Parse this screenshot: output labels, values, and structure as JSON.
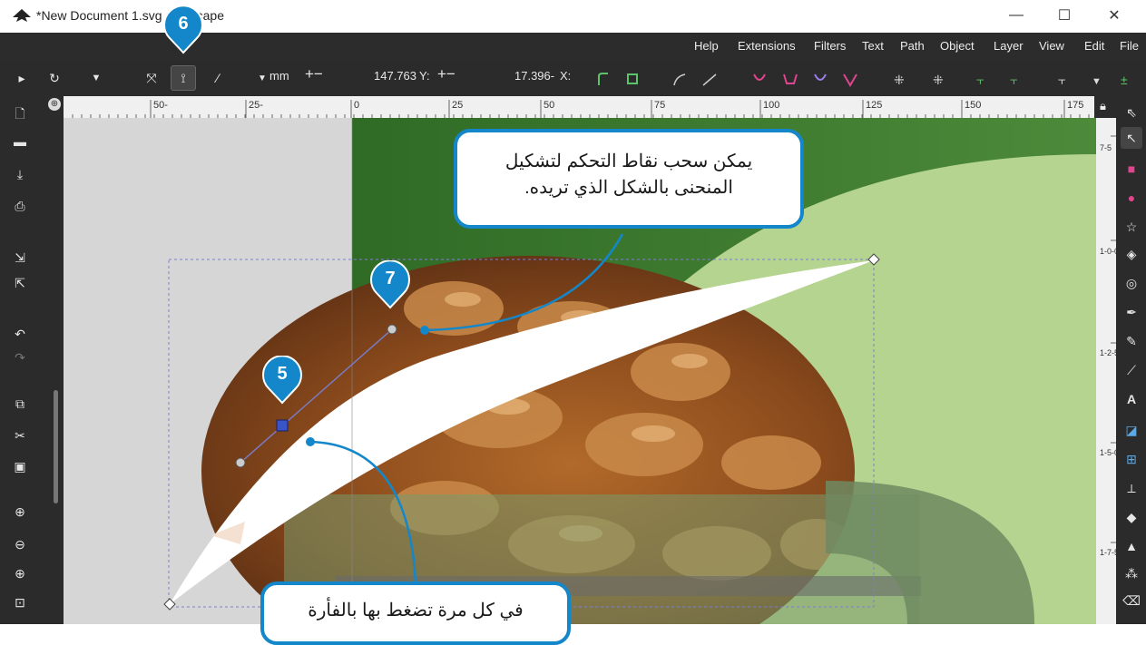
{
  "window": {
    "title": "*New Document 1.svg - Inkscape",
    "minimize": "—",
    "maximize": "☐",
    "close": "✕"
  },
  "menu": [
    "Help",
    "Extensions",
    "Filters",
    "Text",
    "Path",
    "Object",
    "Layer",
    "View",
    "Edit",
    "File"
  ],
  "toolbar": {
    "unit": "mm",
    "y_label": "Y:",
    "x_label": "X:",
    "y_value": "147.763",
    "x_value": "17.396-",
    "plusminus": "+−"
  },
  "ruler_labels": [
    "50-",
    "25-",
    "0",
    "25",
    "50",
    "75",
    "100",
    "125",
    "150",
    "175"
  ],
  "vruler_labels": [
    "7-5",
    "1-0-0",
    "1-2-5",
    "1-5-0",
    "1-7-5"
  ],
  "callouts": {
    "top": "يمكن سحب نقاط التحكم لتشكيل المنحنى بالشكل الذي تريده.",
    "bottom": "في كل مرة تضغط بها بالفأرة"
  },
  "badges": {
    "five": "5",
    "six": "6",
    "seven": "7"
  },
  "colors": {
    "accent": "#1387c9",
    "chrome": "#2b2b2b",
    "green_dark": "#3b7a2a",
    "green_light": "#b5d48f"
  }
}
